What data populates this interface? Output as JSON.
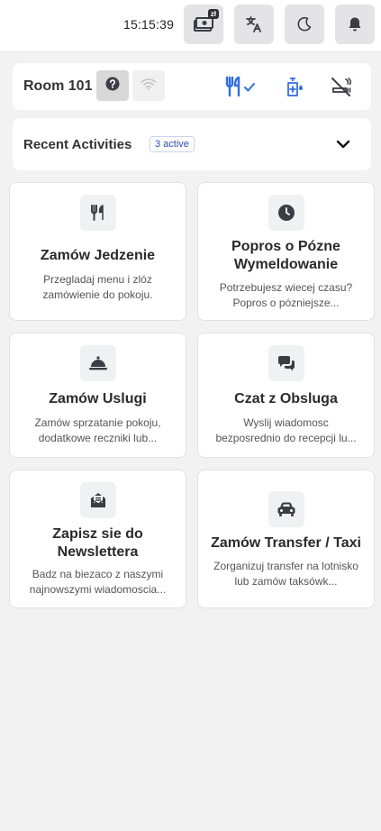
{
  "header": {
    "time": "15:15:39",
    "currency_badge": "zł",
    "buttons": [
      {
        "name": "currency",
        "icon": "money-icon"
      },
      {
        "name": "language",
        "icon": "translate-icon"
      },
      {
        "name": "theme",
        "icon": "moon-icon"
      },
      {
        "name": "notifications",
        "icon": "bell-icon"
      }
    ]
  },
  "room": {
    "title": "Room 101",
    "status_icons": [
      "help-icon",
      "wifi-icon",
      "restaurant-check-icon",
      "sanitizer-icon",
      "no-smoking-icon"
    ],
    "accent": "#2f6fe0"
  },
  "activities": {
    "title": "Recent Activities",
    "badge": "3 active"
  },
  "tiles": [
    {
      "title": "Zamów Jedzenie",
      "desc": "Przegladaj menu i zlóz zamówienie do pokoju.",
      "icon": "utensils-icon"
    },
    {
      "title": "Popros o Pózne Wymeldowanie",
      "desc": "Potrzebujesz wiecej czasu? Popros o pózniejsze...",
      "icon": "clock-icon"
    },
    {
      "title": "Zamów Uslugi",
      "desc": "Zamów sprzatanie pokoju, dodatkowe reczniki lub...",
      "icon": "service-bell-icon"
    },
    {
      "title": "Czat z Obsluga",
      "desc": "Wyslij wiadomosc bezposrednio do recepcji lu...",
      "icon": "chat-icon"
    },
    {
      "title": "Zapisz sie do Newslettera",
      "desc": "Badz na biezaco z naszymi najnowszymi wiadomoscia...",
      "icon": "envelope-open-icon"
    },
    {
      "title": "Zamów Transfer / Taxi",
      "desc": "Zorganizuj transfer na lotnisko lub zamów taksówk...",
      "icon": "car-icon"
    }
  ]
}
